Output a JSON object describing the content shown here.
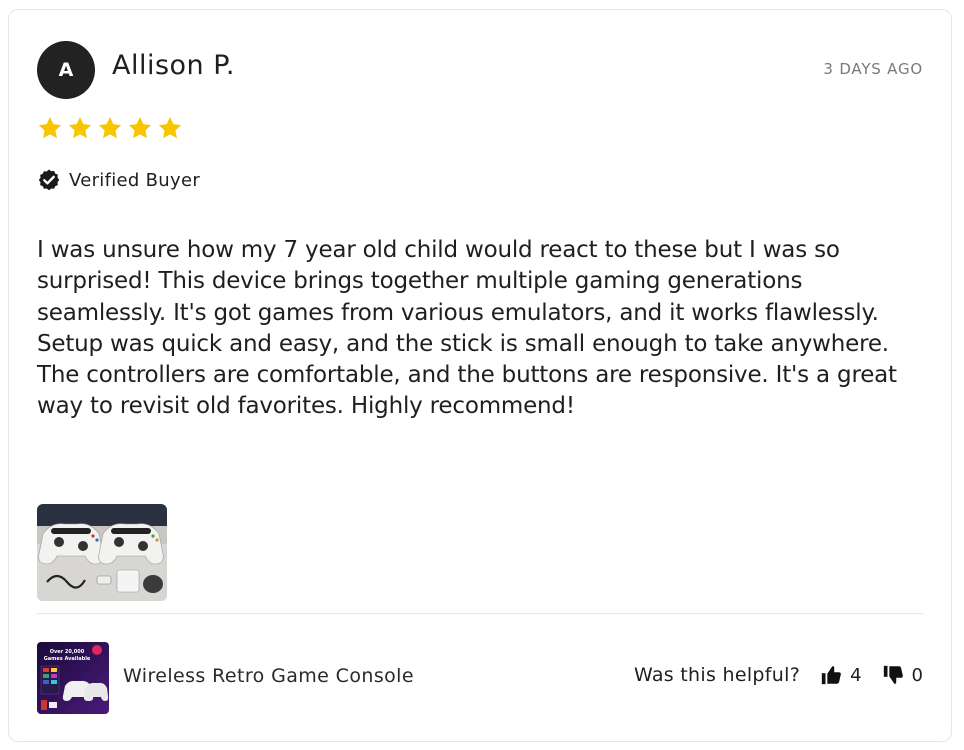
{
  "review": {
    "avatar_initial": "A",
    "author": "Allison P.",
    "date": "3 DAYS AGO",
    "rating": 5,
    "rating_max": 5,
    "star_color": "#f7c600",
    "verified_label": "Verified Buyer",
    "body": "I was unsure how my 7 year old child would react to these but I was so surprised! This device brings together multiple gaming generations seamlessly. It's got games from various emulators, and it works flawlessly. Setup was quick and easy, and the stick is small enough to take anywhere. The controllers are comfortable, and the buttons are responsive. It's a great way to revisit old favorites. Highly recommend!",
    "photo": {
      "icon": "review-photo-controllers"
    }
  },
  "product": {
    "name": "Wireless Retro Game Console",
    "thumb_text_line1": "Over 20,000",
    "thumb_text_line2": "Games Available"
  },
  "helpful": {
    "label": "Was this helpful?",
    "up_count": "4",
    "down_count": "0",
    "up_icon": "thumbs-up-icon",
    "down_icon": "thumbs-down-icon"
  },
  "colors": {
    "avatar_bg": "#222222",
    "date_text": "#7a7a7a",
    "border": "#e6e6e6"
  }
}
